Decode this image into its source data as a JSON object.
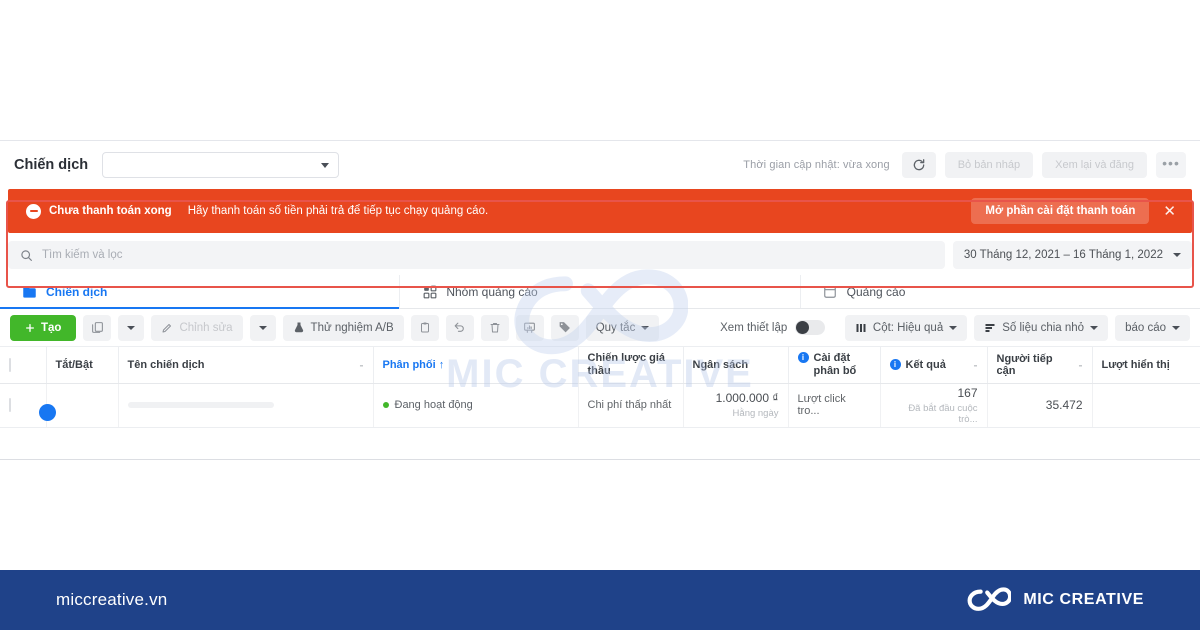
{
  "topbar": {
    "label": "Chiến dịch",
    "select_value": "",
    "update_status": "Thời gian cập nhật: vừa xong",
    "refresh_icon": "refresh-icon",
    "discard_label": "Bỏ bản nháp",
    "review_label": "Xem lại và đăng",
    "more_label": "•••"
  },
  "alert": {
    "icon": "minus-circle-icon",
    "title": "Chưa thanh toán xong",
    "message": "Hãy thanh toán số tiền phải trả để tiếp tục chạy quảng cáo.",
    "action_label": "Mở phần cài đặt thanh toán",
    "close_label": "✕",
    "bg_color": "#e8461f"
  },
  "search": {
    "icon": "search-icon",
    "placeholder": "Tìm kiếm và lọc",
    "value": "",
    "date_range": "30 Tháng 12, 2021 – 16 Tháng 1, 2022"
  },
  "tabs": [
    {
      "label": "Chiến dịch",
      "icon": "campaign-folder-icon",
      "active": true
    },
    {
      "label": "Nhóm quảng cáo",
      "icon": "adset-grid-icon",
      "active": false
    },
    {
      "label": "Quảng cáo",
      "icon": "ad-square-icon",
      "active": false
    }
  ],
  "toolbar": {
    "create_label": "Tạo",
    "create_icon": "plus-icon",
    "duplicate_icon": "duplicate-icon",
    "duplicate_caret": "chevron-down-icon",
    "edit_label": "Chỉnh sửa",
    "edit_icon": "pencil-icon",
    "edit_caret": "chevron-down-icon",
    "abtest_label": "Thử nghiệm A/B",
    "abtest_icon": "ab-test-icon",
    "copy_icon": "clipboard-icon",
    "undo_icon": "undo-icon",
    "delete_icon": "trash-icon",
    "chart_icon": "bar-chart-icon",
    "tag_icon": "tag-icon",
    "rules_label": "Quy tắc",
    "view_setup_label": "Xem thiết lập",
    "columns_label": "Cột: Hiệu quả",
    "columns_icon": "columns-icon",
    "breakdown_label": "Số liệu chia nhỏ",
    "breakdown_icon": "breakdown-icon",
    "reports_label": "báo cáo"
  },
  "table": {
    "columns": [
      {
        "label": "",
        "name": "select-all"
      },
      {
        "label": "Tắt/Bật",
        "name": "on-off"
      },
      {
        "label": "Tên chiến dịch",
        "name": "campaign-name"
      },
      {
        "label": "Phân phối ↑",
        "name": "delivery",
        "sorted": true
      },
      {
        "label": "Chiến lược giá thầu",
        "name": "bid-strategy"
      },
      {
        "label": "Ngân sách",
        "name": "budget"
      },
      {
        "label": "Cài đặt phân bổ",
        "name": "attribution-setting",
        "info": true
      },
      {
        "label": "Kết quả",
        "name": "results",
        "info": true
      },
      {
        "label": "Người tiếp cận",
        "name": "reach"
      },
      {
        "label": "Lượt hiển thị",
        "name": "impressions"
      }
    ],
    "rows": [
      {
        "toggle_on": true,
        "campaign_name": "",
        "delivery": "Đang hoạt động",
        "bid_strategy": "Chi phí thấp nhất",
        "budget": "1.000.000 ₫",
        "budget_sub": "Hằng ngày",
        "attribution": "Lượt click tro...",
        "results": "167",
        "results_sub": "Đã bắt đầu cuộc trò...",
        "reach": "35.472",
        "impressions": ""
      }
    ]
  },
  "watermark": {
    "text": "MIC CREATIVE",
    "mark": "infinity-icon"
  },
  "footer": {
    "url": "miccreative.vn",
    "brand_name": "MIC CREATIVE",
    "logo_icon": "infinity-logo-icon",
    "bg_color": "#1f4289"
  }
}
